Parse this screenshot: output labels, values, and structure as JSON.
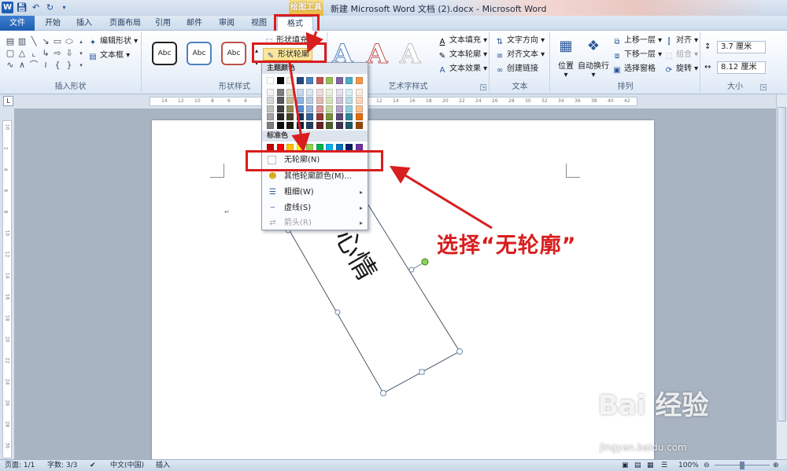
{
  "window": {
    "context_tool": "绘图工具",
    "title": "新建 Microsoft Word 文档 (2).docx - Microsoft Word",
    "app_icon": "W"
  },
  "tabs": [
    "文件",
    "开始",
    "插入",
    "页面布局",
    "引用",
    "邮件",
    "审阅",
    "视图",
    "格式"
  ],
  "ribbon": {
    "insert_shapes": {
      "label": "插入形状",
      "edit_shape": "编辑形状",
      "text_box": "文本框"
    },
    "shape_styles": {
      "label": "形状样式",
      "swatch_text": "Abc",
      "shape_fill": "形状填充",
      "shape_outline": "形状轮廓"
    },
    "wordart": {
      "label": "艺术字样式",
      "letter": "A",
      "text_fill": "文本填充",
      "text_outline": "文本轮廓",
      "text_effects": "文本效果"
    },
    "text": {
      "label": "文本",
      "direction": "文字方向",
      "align": "对齐文本",
      "link": "创建链接"
    },
    "arrange": {
      "label": "排列",
      "position": "位置",
      "wrap": "自动换行",
      "bring_forward": "上移一层",
      "send_backward": "下移一层",
      "selection_pane": "选择窗格",
      "align": "对齐",
      "group": "组合",
      "rotate": "旋转"
    },
    "size": {
      "label": "大小",
      "height": "3.7 厘米",
      "width": "8.12 厘米"
    }
  },
  "ruler": {
    "top_ticks": [
      "14",
      "12",
      "10",
      "8",
      "6",
      "4",
      "2",
      "",
      "2",
      "4",
      "6",
      "8",
      "10",
      "12",
      "14",
      "16",
      "18",
      "20",
      "22",
      "24",
      "26",
      "28",
      "30",
      "32",
      "34",
      "36",
      "38",
      "40",
      "42"
    ],
    "left_ticks": [
      "10",
      "2",
      "4",
      "6",
      "8",
      "10",
      "12",
      "14",
      "16",
      "18",
      "20",
      "22",
      "24",
      "26",
      "28",
      "30"
    ]
  },
  "document": {
    "textbox_text": "心情",
    "paragraph_mark": "↵"
  },
  "menu": {
    "theme_colors_header": "主题颜色",
    "standard_colors_header": "标准色",
    "theme_colors": [
      [
        "#ffffff",
        "#000000",
        "#eeece1",
        "#1f497d",
        "#4f81bd",
        "#c0504d",
        "#9bbb59",
        "#8064a2",
        "#4bacc6",
        "#f79646"
      ],
      [
        "#f2f2f2",
        "#7f7f7f",
        "#ddd9c3",
        "#c6d9f0",
        "#dbe5f1",
        "#f2dcdb",
        "#ebf1dd",
        "#e5e0ec",
        "#dbeef3",
        "#fdeada"
      ],
      [
        "#d8d8d8",
        "#595959",
        "#c4bd97",
        "#8db3e2",
        "#b8cce4",
        "#e5b9b7",
        "#d7e3bc",
        "#ccc1d9",
        "#b7dde8",
        "#fbd5b5"
      ],
      [
        "#bfbfbf",
        "#3f3f3f",
        "#938953",
        "#548dd4",
        "#95b3d7",
        "#d99694",
        "#c3d69b",
        "#b2a2c7",
        "#92cddc",
        "#fac08f"
      ],
      [
        "#a5a5a5",
        "#262626",
        "#494429",
        "#17365d",
        "#366092",
        "#953734",
        "#76923c",
        "#5f497a",
        "#31859b",
        "#e36c09"
      ],
      [
        "#7f7f7f",
        "#0c0c0c",
        "#1d1b10",
        "#0f243e",
        "#244061",
        "#632423",
        "#4f6128",
        "#3f3151",
        "#205867",
        "#974806"
      ]
    ],
    "standard_colors": [
      "#c00000",
      "#ff0000",
      "#ffc000",
      "#ffff00",
      "#92d050",
      "#00b050",
      "#00b0f0",
      "#0070c0",
      "#002060",
      "#7030a0"
    ],
    "items": [
      {
        "label": "无轮廓(N)",
        "icon": "no-outline-icon",
        "arrow": ""
      },
      {
        "label": "其他轮廓颜色(M)...",
        "icon": "color-wheel-icon",
        "arrow": ""
      },
      {
        "label": "粗细(W)",
        "icon": "line-weight-icon",
        "arrow": "▸"
      },
      {
        "label": "虚线(S)",
        "icon": "dash-line-icon",
        "arrow": "▸"
      },
      {
        "label": "箭头(R)",
        "icon": "arrow-style-icon",
        "arrow": "▸"
      }
    ]
  },
  "annotation": {
    "text": "选择“无轮廓”",
    "color": "#d81e1e"
  },
  "status": {
    "page": "页面: 1/1",
    "words": "字数: 3/3",
    "language": "中文(中国)",
    "mode": "插入",
    "zoom": "100%"
  },
  "watermark": {
    "brand": "Bai 经验",
    "url": "jingyan.baidu.com"
  }
}
